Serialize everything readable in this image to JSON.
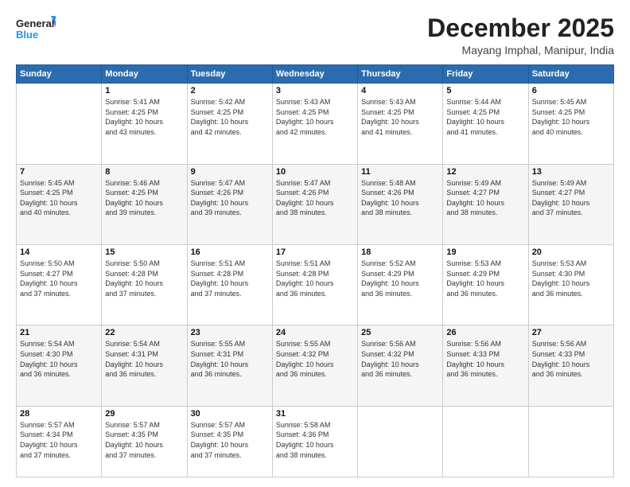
{
  "logo": {
    "line1": "General",
    "line2": "Blue"
  },
  "title": "December 2025",
  "subtitle": "Mayang Imphal, Manipur, India",
  "days": [
    "Sunday",
    "Monday",
    "Tuesday",
    "Wednesday",
    "Thursday",
    "Friday",
    "Saturday"
  ],
  "weeks": [
    [
      {
        "date": "",
        "info": ""
      },
      {
        "date": "1",
        "info": "Sunrise: 5:41 AM\nSunset: 4:25 PM\nDaylight: 10 hours\nand 43 minutes."
      },
      {
        "date": "2",
        "info": "Sunrise: 5:42 AM\nSunset: 4:25 PM\nDaylight: 10 hours\nand 42 minutes."
      },
      {
        "date": "3",
        "info": "Sunrise: 5:43 AM\nSunset: 4:25 PM\nDaylight: 10 hours\nand 42 minutes."
      },
      {
        "date": "4",
        "info": "Sunrise: 5:43 AM\nSunset: 4:25 PM\nDaylight: 10 hours\nand 41 minutes."
      },
      {
        "date": "5",
        "info": "Sunrise: 5:44 AM\nSunset: 4:25 PM\nDaylight: 10 hours\nand 41 minutes."
      },
      {
        "date": "6",
        "info": "Sunrise: 5:45 AM\nSunset: 4:25 PM\nDaylight: 10 hours\nand 40 minutes."
      }
    ],
    [
      {
        "date": "7",
        "info": "Sunrise: 5:45 AM\nSunset: 4:25 PM\nDaylight: 10 hours\nand 40 minutes."
      },
      {
        "date": "8",
        "info": "Sunrise: 5:46 AM\nSunset: 4:25 PM\nDaylight: 10 hours\nand 39 minutes."
      },
      {
        "date": "9",
        "info": "Sunrise: 5:47 AM\nSunset: 4:26 PM\nDaylight: 10 hours\nand 39 minutes."
      },
      {
        "date": "10",
        "info": "Sunrise: 5:47 AM\nSunset: 4:26 PM\nDaylight: 10 hours\nand 38 minutes."
      },
      {
        "date": "11",
        "info": "Sunrise: 5:48 AM\nSunset: 4:26 PM\nDaylight: 10 hours\nand 38 minutes."
      },
      {
        "date": "12",
        "info": "Sunrise: 5:49 AM\nSunset: 4:27 PM\nDaylight: 10 hours\nand 38 minutes."
      },
      {
        "date": "13",
        "info": "Sunrise: 5:49 AM\nSunset: 4:27 PM\nDaylight: 10 hours\nand 37 minutes."
      }
    ],
    [
      {
        "date": "14",
        "info": "Sunrise: 5:50 AM\nSunset: 4:27 PM\nDaylight: 10 hours\nand 37 minutes."
      },
      {
        "date": "15",
        "info": "Sunrise: 5:50 AM\nSunset: 4:28 PM\nDaylight: 10 hours\nand 37 minutes."
      },
      {
        "date": "16",
        "info": "Sunrise: 5:51 AM\nSunset: 4:28 PM\nDaylight: 10 hours\nand 37 minutes."
      },
      {
        "date": "17",
        "info": "Sunrise: 5:51 AM\nSunset: 4:28 PM\nDaylight: 10 hours\nand 36 minutes."
      },
      {
        "date": "18",
        "info": "Sunrise: 5:52 AM\nSunset: 4:29 PM\nDaylight: 10 hours\nand 36 minutes."
      },
      {
        "date": "19",
        "info": "Sunrise: 5:53 AM\nSunset: 4:29 PM\nDaylight: 10 hours\nand 36 minutes."
      },
      {
        "date": "20",
        "info": "Sunrise: 5:53 AM\nSunset: 4:30 PM\nDaylight: 10 hours\nand 36 minutes."
      }
    ],
    [
      {
        "date": "21",
        "info": "Sunrise: 5:54 AM\nSunset: 4:30 PM\nDaylight: 10 hours\nand 36 minutes."
      },
      {
        "date": "22",
        "info": "Sunrise: 5:54 AM\nSunset: 4:31 PM\nDaylight: 10 hours\nand 36 minutes."
      },
      {
        "date": "23",
        "info": "Sunrise: 5:55 AM\nSunset: 4:31 PM\nDaylight: 10 hours\nand 36 minutes."
      },
      {
        "date": "24",
        "info": "Sunrise: 5:55 AM\nSunset: 4:32 PM\nDaylight: 10 hours\nand 36 minutes."
      },
      {
        "date": "25",
        "info": "Sunrise: 5:56 AM\nSunset: 4:32 PM\nDaylight: 10 hours\nand 36 minutes."
      },
      {
        "date": "26",
        "info": "Sunrise: 5:56 AM\nSunset: 4:33 PM\nDaylight: 10 hours\nand 36 minutes."
      },
      {
        "date": "27",
        "info": "Sunrise: 5:56 AM\nSunset: 4:33 PM\nDaylight: 10 hours\nand 36 minutes."
      }
    ],
    [
      {
        "date": "28",
        "info": "Sunrise: 5:57 AM\nSunset: 4:34 PM\nDaylight: 10 hours\nand 37 minutes."
      },
      {
        "date": "29",
        "info": "Sunrise: 5:57 AM\nSunset: 4:35 PM\nDaylight: 10 hours\nand 37 minutes."
      },
      {
        "date": "30",
        "info": "Sunrise: 5:57 AM\nSunset: 4:35 PM\nDaylight: 10 hours\nand 37 minutes."
      },
      {
        "date": "31",
        "info": "Sunrise: 5:58 AM\nSunset: 4:36 PM\nDaylight: 10 hours\nand 38 minutes."
      },
      {
        "date": "",
        "info": ""
      },
      {
        "date": "",
        "info": ""
      },
      {
        "date": "",
        "info": ""
      }
    ]
  ]
}
